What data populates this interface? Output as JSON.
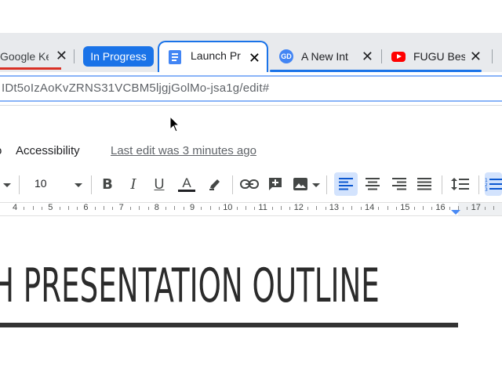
{
  "browser": {
    "tabs": [
      {
        "title": "Google Ke",
        "icon": "google-keep-icon"
      },
      {
        "title": "Launch Pr",
        "icon": "google-docs-icon",
        "active": true
      },
      {
        "title": "A New Int",
        "icon": "gd-icon"
      },
      {
        "title": "FUGU Bes",
        "icon": "youtube-icon"
      }
    ],
    "tab_group_label": "In Progress",
    "tab_group_color": "#1a73e8",
    "gd_badge": "GD",
    "url": "IDt5oIzAoKvZRNS31VCBM5ljgjGolMo-jsa1g/edit#"
  },
  "docs": {
    "menu_partial": "o",
    "menu_accessibility": "Accessibility",
    "last_edit": "Last edit was 3 minutes ago",
    "font_size": "10",
    "ruler_numbers": [
      "4",
      "5",
      "6",
      "7",
      "8",
      "9",
      "10",
      "11",
      "12",
      "13",
      "14",
      "15",
      "16",
      "17"
    ],
    "heading": "H PRESENTATION OUTLINE"
  },
  "colors": {
    "accent": "#1a73e8",
    "active_button_bg": "#d3e3fd"
  }
}
